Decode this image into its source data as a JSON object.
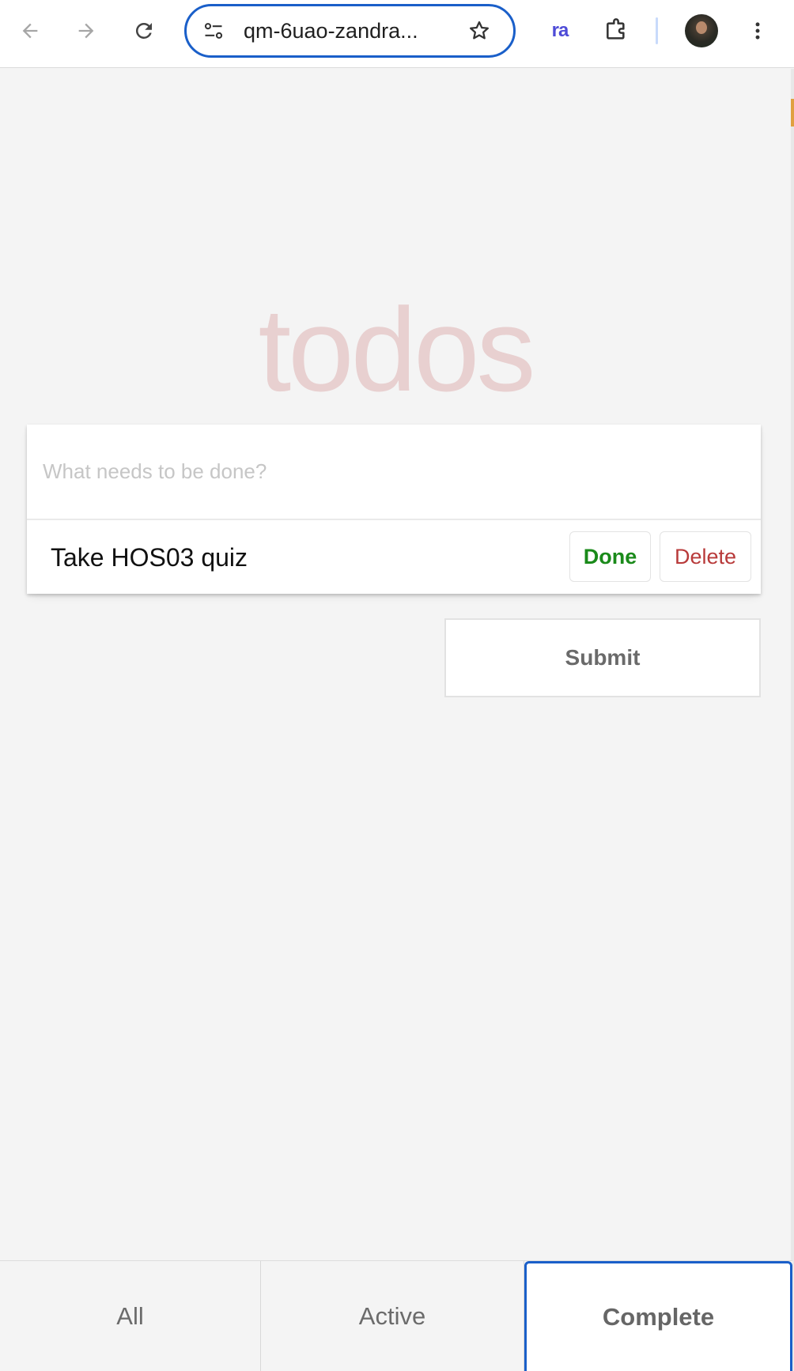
{
  "browser": {
    "url": "qm-6uao-zandra...",
    "extension_label": "ra",
    "icons": {
      "back": "arrow-left-icon",
      "forward": "arrow-right-icon",
      "reload": "reload-icon",
      "site_info": "tune-icon",
      "bookmark": "star-icon",
      "extensions": "puzzle-icon",
      "menu": "more-vert-icon"
    }
  },
  "app": {
    "title": "todos",
    "new_todo_placeholder": "What needs to be done?",
    "new_todo_value": "",
    "todos": [
      {
        "label": "Take HOS03 quiz",
        "done_label": "Done",
        "delete_label": "Delete"
      }
    ],
    "submit_label": "Submit"
  },
  "filters": {
    "all": "All",
    "active": "Active",
    "complete": "Complete",
    "selected": "complete"
  },
  "colors": {
    "accent": "#1a5fc9",
    "done": "#1a8a1a",
    "delete": "#b83a3a",
    "title": "#af2f2f"
  }
}
